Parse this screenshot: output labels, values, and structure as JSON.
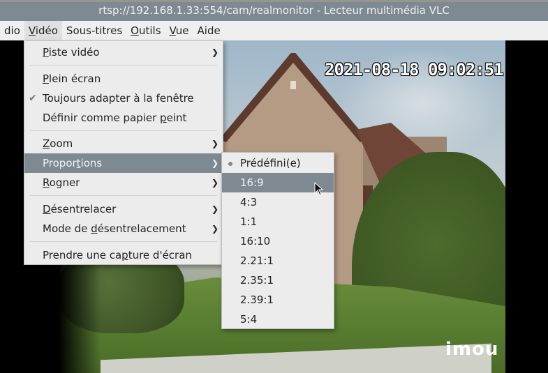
{
  "window": {
    "title": "rtsp://192.168.1.33:554/cam/realmonitor - Lecteur multimédia VLC"
  },
  "menubar": {
    "items": [
      {
        "label": "dio",
        "ul": ""
      },
      {
        "pre": "",
        "ul": "V",
        "post": "idéo"
      },
      {
        "pre": "",
        "ul": "",
        "post": "Sous-titres"
      },
      {
        "pre": "",
        "ul": "O",
        "post": "utils"
      },
      {
        "pre": "",
        "ul": "V",
        "post": "ue"
      },
      {
        "pre": "",
        "ul": "",
        "post": "Aide"
      }
    ]
  },
  "video_menu": {
    "items": [
      {
        "pre": "",
        "ul": "P",
        "post": "iste vidéo",
        "submenu": true
      },
      {
        "pre": "",
        "ul": "P",
        "post": "lein écran"
      },
      {
        "pre": "",
        "ul": "",
        "post": "Toujours adapter à la fenêtre",
        "checked": true
      },
      {
        "pre": "Définir comme papier ",
        "ul": "p",
        "post": "eint"
      },
      {
        "pre": "",
        "ul": "Z",
        "post": "oom",
        "submenu": true
      },
      {
        "pre": "Propor",
        "ul": "t",
        "post": "ions",
        "submenu": true,
        "highlighted": true
      },
      {
        "pre": "",
        "ul": "R",
        "post": "ogner",
        "submenu": true
      },
      {
        "pre": "",
        "ul": "D",
        "post": "ésentrelacer",
        "submenu": true
      },
      {
        "pre": "Mode de ",
        "ul": "d",
        "post": "ésentrelacement",
        "submenu": true
      },
      {
        "pre": "Prendre une ca",
        "ul": "p",
        "post": "ture d'écran"
      }
    ]
  },
  "aspect_submenu": {
    "items": [
      {
        "label": "Prédéfini(e)",
        "selected": true
      },
      {
        "label": "16:9",
        "highlighted": true
      },
      {
        "label": "4:3"
      },
      {
        "label": "1:1"
      },
      {
        "label": "16:10"
      },
      {
        "label": "2.21:1"
      },
      {
        "label": "2.35:1"
      },
      {
        "label": "2.39:1"
      },
      {
        "label": "5:4"
      }
    ]
  },
  "video": {
    "timestamp": "2021-08-18 09:02:51",
    "watermark": "imou"
  },
  "icons": {
    "submenu_arrow": "chevron-right-icon",
    "check": "check-icon",
    "radio": "radio-dot-icon",
    "cursor": "mouse-cursor-icon"
  },
  "colors": {
    "titlebar": "#7f8992",
    "highlight": "#7f8992",
    "menu_bg": "#ececec"
  }
}
